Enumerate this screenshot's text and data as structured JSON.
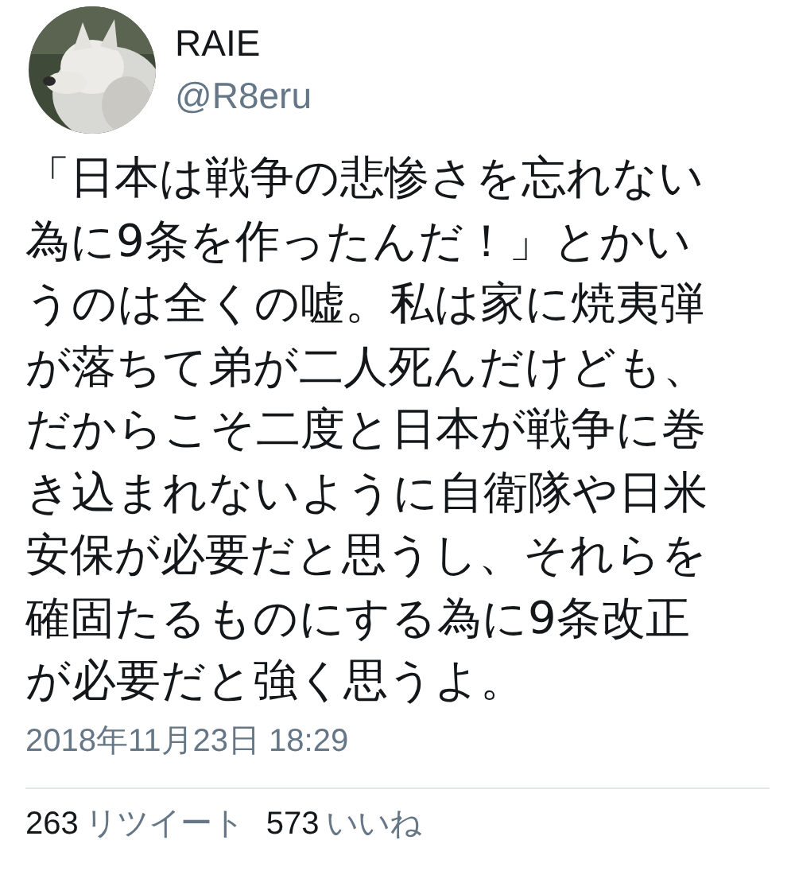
{
  "author": {
    "name": "RAIE",
    "handle": "@R8eru"
  },
  "tweet": {
    "lines": [
      "「日本は戦争の悲惨さを忘れない",
      "為に9条を作ったんだ！」とかい",
      "うのは全くの嘘。私は家に焼夷弾",
      "が落ちて弟が二人死んだけども、",
      "だからこそ二度と日本が戦争に巻",
      "き込まれないように自衛隊や日米",
      "安保が必要だと思うし、それらを",
      "確固たるものにする為に9条改正",
      "が必要だと強く思うよ。"
    ],
    "timestamp": "2018年11月23日 18:29"
  },
  "stats": [
    {
      "count": "263",
      "label": "リツイート"
    },
    {
      "count": "573",
      "label": "いいね"
    }
  ]
}
